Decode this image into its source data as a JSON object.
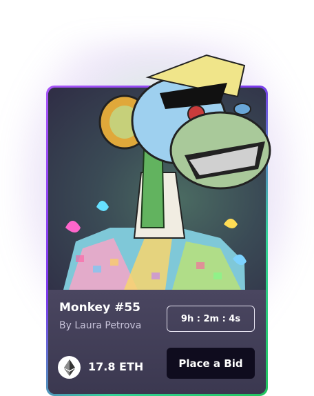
{
  "card": {
    "title": "Monkey #55",
    "author": "By Laura Petrova",
    "timer": "9h : 2m : 4s",
    "price": "17.8 ETH",
    "bid_label": "Place a Bid",
    "currency_icon": "ethereum-icon"
  },
  "colors": {
    "border_start": "#a855f7",
    "border_end": "#22c55e",
    "card_bg": "#2d2a40",
    "info_bg": "#4a4660",
    "button_bg": "#0f0c1e"
  }
}
